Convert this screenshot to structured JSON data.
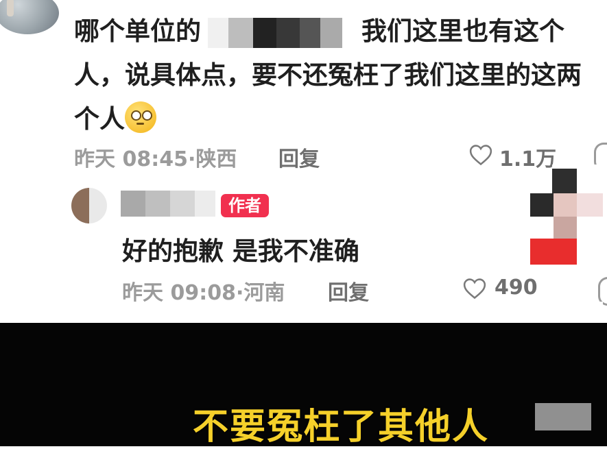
{
  "comment1": {
    "text_line1_before": "哪个单位的",
    "text_line1_after": "我们这里也有这个",
    "text_line2": "人，说具体点，要不还冤枉了我们这里的这两",
    "text_line3": "个人",
    "emoji_icon": "face-with-rolling-eyes-icon",
    "time": "昨天 08:45",
    "location": "陕西",
    "reply_label": "回复",
    "likes": "1.1万"
  },
  "comment2": {
    "author_badge": "作者",
    "text": "好的抱歉 是我不准确",
    "time": "昨天 09:08",
    "location": "河南",
    "reply_label": "回复",
    "likes": "490"
  },
  "subtitle": "不要冤枉了其他人",
  "colors": {
    "text": "#1f1f1f",
    "meta": "#9b9b9b",
    "badge": "#f1304f",
    "subtitle": "#f5d02a",
    "banner": "#050505"
  }
}
